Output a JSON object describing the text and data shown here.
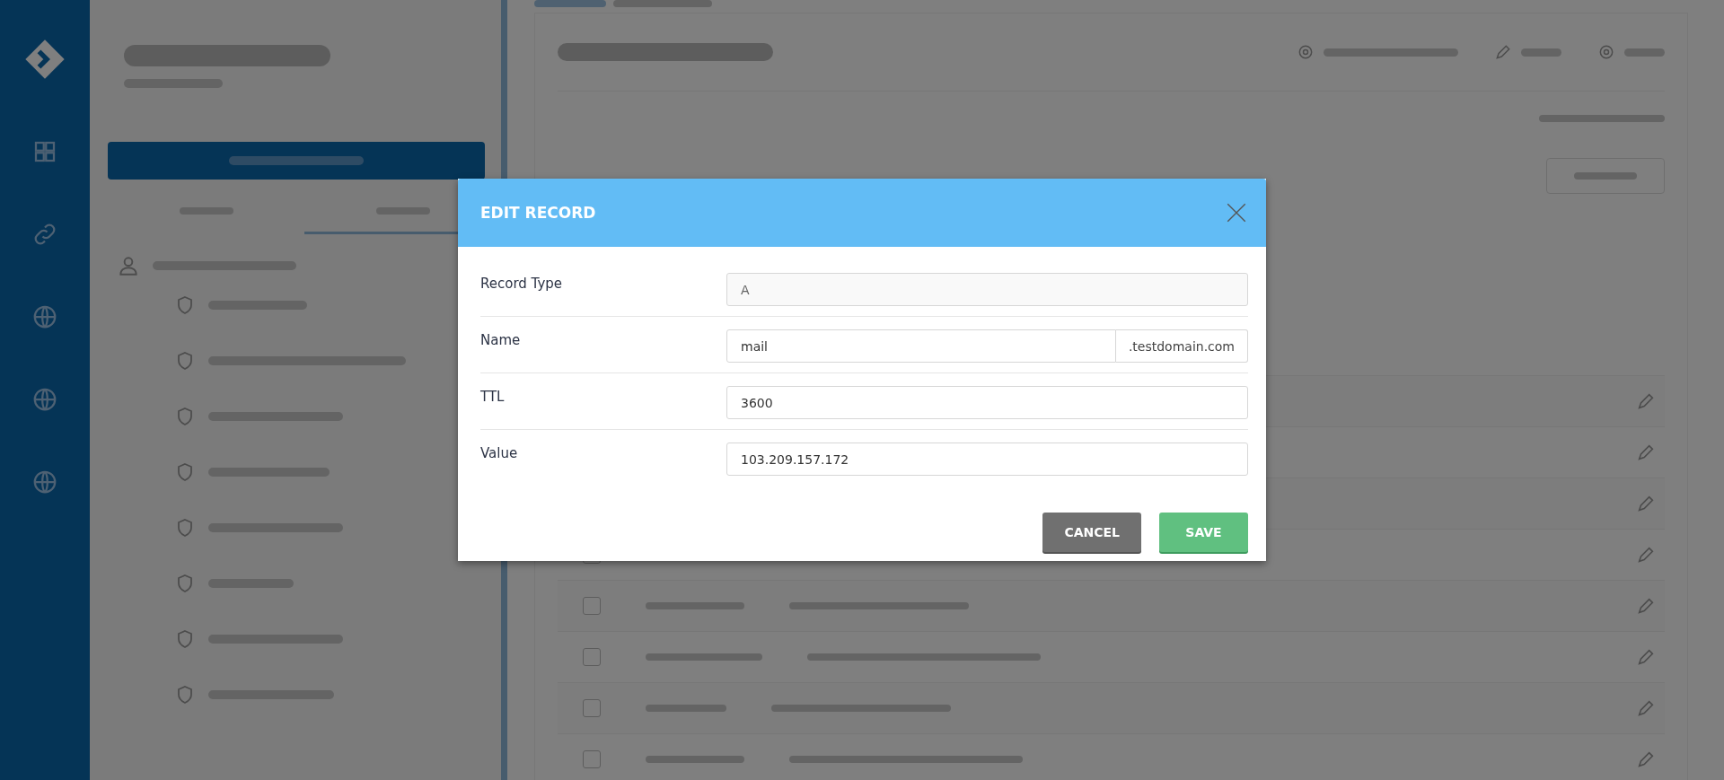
{
  "table": {
    "rows": [
      {
        "checked": false
      },
      {
        "checked": false
      },
      {
        "checked": false
      },
      {
        "checked": false
      }
    ]
  },
  "modal": {
    "title": "EDIT RECORD",
    "fields": [
      {
        "kind": "readonly",
        "label": "Record Type",
        "value": "A"
      },
      {
        "kind": "suffixed",
        "label": "Name",
        "value": "mail",
        "suffix": ".testdomain.com"
      },
      {
        "kind": "text",
        "label": "TTL",
        "value": "3600"
      },
      {
        "kind": "text",
        "label": "Value",
        "value": "103.209.157.172"
      }
    ],
    "buttons": [
      {
        "kind": "cancel",
        "label": "CANCEL"
      },
      {
        "kind": "save",
        "label": "SAVE"
      }
    ]
  }
}
